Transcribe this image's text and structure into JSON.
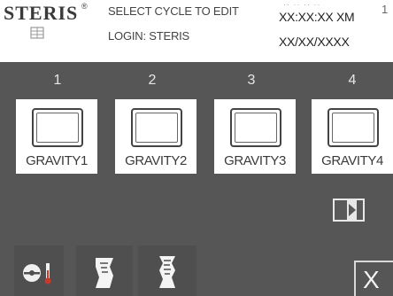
{
  "header": {
    "brand": "STERIS",
    "brand_mark": "®",
    "title": "SELECT CYCLE TO EDIT",
    "login": "LOGIN: STERIS",
    "time": "XX:XX:XX XM",
    "date": "XX/XX/XXXX",
    "faded_time": "·· ·· ·· ··",
    "edge_text": "1"
  },
  "cycles": [
    {
      "number": "1",
      "label": "GRAVITY1",
      "icon": "chamber-icon"
    },
    {
      "number": "2",
      "label": "GRAVITY2",
      "icon": "chamber-icon"
    },
    {
      "number": "3",
      "label": "GRAVITY3",
      "icon": "chamber-icon"
    },
    {
      "number": "4",
      "label": "GRAVITY4",
      "icon": "chamber-icon"
    }
  ],
  "navigation": {
    "next_icon": "next-page-icon"
  },
  "toolbar": {
    "items": [
      {
        "icon": "sensor-thermometer-icon"
      },
      {
        "icon": "printout-icon"
      },
      {
        "icon": "report-icon"
      }
    ],
    "exit_label": "X"
  },
  "colors": {
    "background": "#565656",
    "header": "#ffffff",
    "button": "#ffffff",
    "label_text": "#3a3a3a"
  }
}
